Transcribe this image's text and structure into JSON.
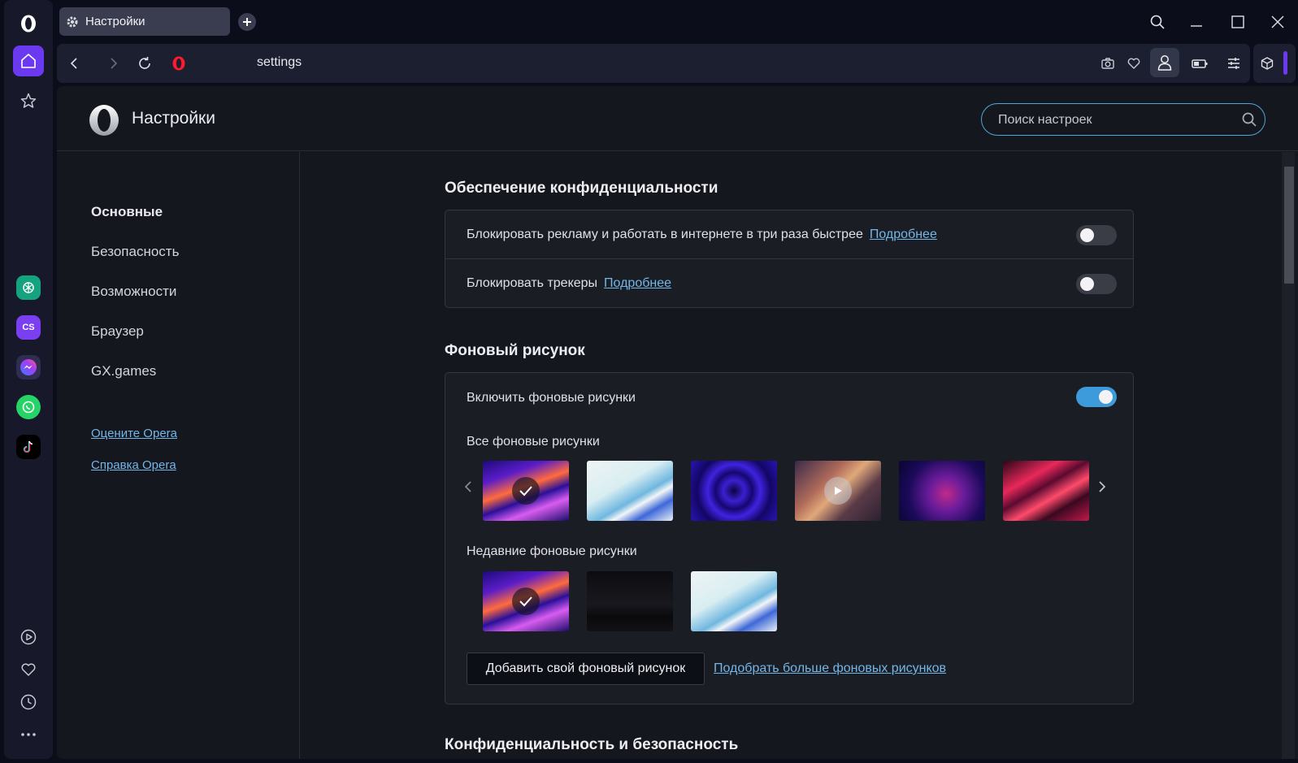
{
  "tab": {
    "title": "Настройки"
  },
  "address": {
    "url": "settings"
  },
  "page": {
    "title": "Настройки",
    "search_placeholder": "Поиск настроек"
  },
  "nav": {
    "items": [
      "Основные",
      "Безопасность",
      "Возможности",
      "Браузер",
      "GX.games"
    ],
    "active": "Основные",
    "links": [
      "Оцените Opera",
      "Справка Opera"
    ]
  },
  "sidebar_apps": {
    "cs_label": "CS"
  },
  "privacy": {
    "title": "Обеспечение конфиденциальности",
    "rows": [
      {
        "label": "Блокировать рекламу и работать в интернете в три раза быстрее",
        "link": "Подробнее",
        "enabled": false
      },
      {
        "label": "Блокировать трекеры",
        "link": "Подробнее",
        "enabled": false
      }
    ]
  },
  "wallpaper": {
    "title": "Фоновый рисунок",
    "enable_label": "Включить фоновые рисунки",
    "enabled": true,
    "all_label": "Все фоновые рисунки",
    "recent_label": "Недавние фоновые рисунки",
    "add_button": "Добавить свой фоновый рисунок",
    "more_link": "Подобрать больше фоновых рисунков"
  },
  "next_section": {
    "title": "Конфиденциальность и безопасность"
  },
  "colors": {
    "accent": "#6b39f0",
    "link": "#73b6e8",
    "toggle_on": "#3d9bdc"
  }
}
